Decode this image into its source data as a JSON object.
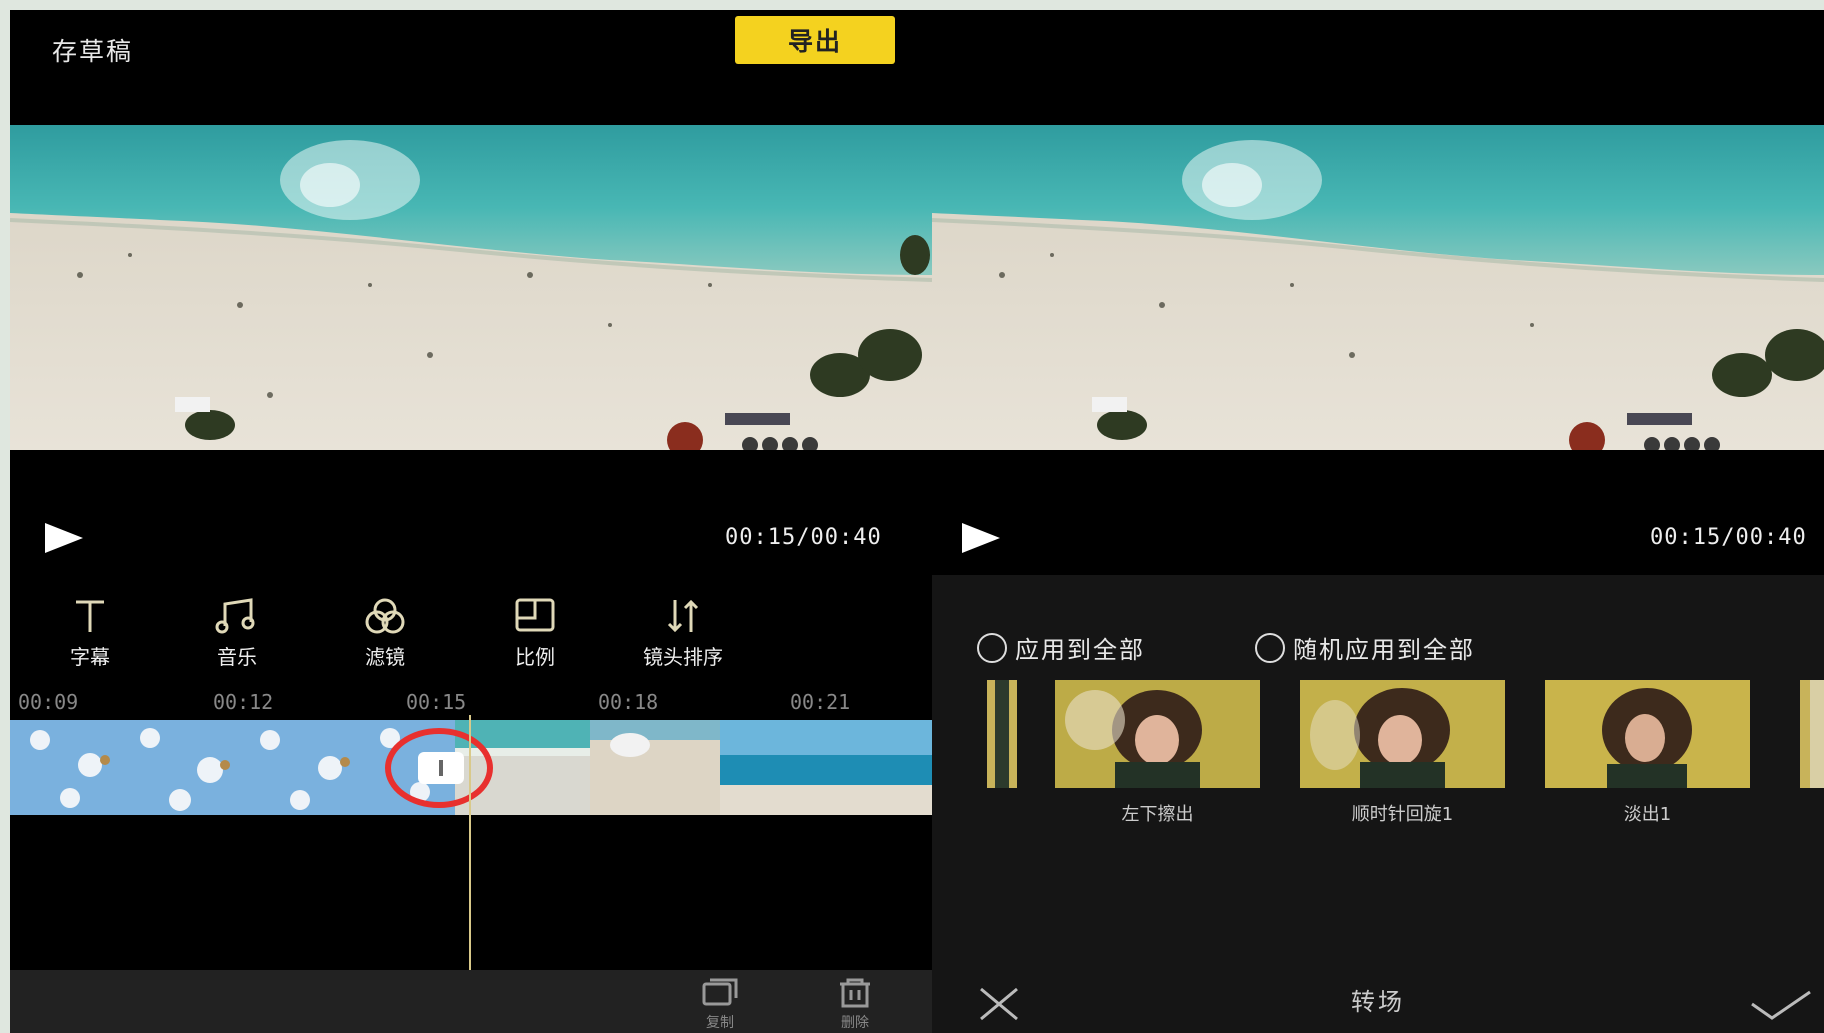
{
  "left": {
    "draft_label": "存草稿",
    "export_label": "导出",
    "time": "00:15/00:40",
    "tools": [
      {
        "icon": "text-icon",
        "label": "字幕"
      },
      {
        "icon": "music-icon",
        "label": "音乐"
      },
      {
        "icon": "filter-icon",
        "label": "滤镜"
      },
      {
        "icon": "ratio-icon",
        "label": "比例"
      },
      {
        "icon": "sort-icon",
        "label": "镜头排序"
      }
    ],
    "ruler": [
      "00:09",
      "00:12",
      "00:15",
      "00:18",
      "00:21"
    ],
    "bottom_tools": [
      {
        "icon": "copy-icon",
        "label": "复制"
      },
      {
        "icon": "trash-icon",
        "label": "删除"
      }
    ]
  },
  "right": {
    "time": "00:15/00:40",
    "options": [
      "应用到全部",
      "随机应用到全部"
    ],
    "transitions": [
      "左下擦出",
      "顺时针回旋1",
      "淡出1"
    ],
    "bottom_title": "转场"
  },
  "colors": {
    "export_bg": "#f4d21f",
    "highlight_ring": "#e8302e",
    "playhead": "#d9c98a"
  }
}
